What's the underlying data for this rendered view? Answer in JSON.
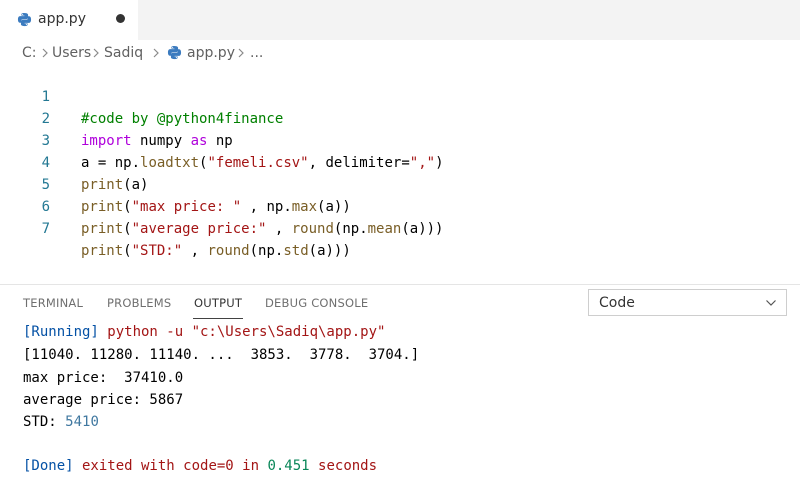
{
  "tab": {
    "filename": "app.py"
  },
  "breadcrumb": {
    "drive": "C:",
    "users": "Users",
    "user": "Sadiq",
    "file": "app.py",
    "more": "..."
  },
  "editor": {
    "lines": [
      {
        "n": "1",
        "parts": [
          "#code by @python4finance"
        ]
      },
      {
        "n": "2",
        "parts": [
          "import",
          " numpy ",
          "as",
          " np"
        ]
      },
      {
        "n": "3",
        "parts": [
          "a = np.",
          "loadtxt",
          "(",
          "\"femeli.csv\"",
          ", delimiter=",
          "\",\"",
          ")"
        ]
      },
      {
        "n": "4",
        "parts": [
          "print",
          "(a)"
        ]
      },
      {
        "n": "5",
        "parts": [
          "print",
          "(",
          "\"max price: \"",
          " , np.",
          "max",
          "(a))"
        ]
      },
      {
        "n": "6",
        "parts": [
          "print",
          "(",
          "\"average price:\"",
          " , ",
          "round",
          "(np.",
          "mean",
          "(a)))"
        ]
      },
      {
        "n": "7",
        "parts": [
          "print",
          "(",
          "\"STD:\"",
          " , ",
          "round",
          "(np.",
          "std",
          "(a)))"
        ]
      }
    ]
  },
  "panel": {
    "tabs": [
      "TERMINAL",
      "PROBLEMS",
      "OUTPUT",
      "DEBUG CONSOLE"
    ],
    "active_tab": "OUTPUT",
    "channel_selected": "Code"
  },
  "output": {
    "running_tag": "[Running]",
    "running_cmd": " python -u \"c:\\Users\\Sadiq\\app.py\"",
    "array_line": "[11040. 11280. 11140. ...  3853.  3778.  3704.]",
    "max_line": "max price:  37410.0",
    "avg_line": "average price: 5867",
    "std_label": "STD: ",
    "std_value": "5410",
    "done_tag": "[Done]",
    "done_text1": " exited with ",
    "done_code": "code=0",
    "done_text2": " in ",
    "done_time": "0.451",
    "done_text3": " seconds"
  }
}
